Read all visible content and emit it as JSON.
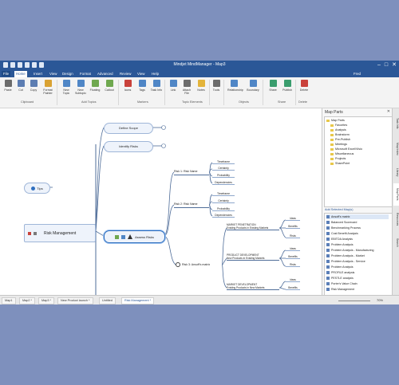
{
  "window": {
    "title": "Mindjet MindManager - Map3"
  },
  "ribbon_tabs": [
    "File",
    "Home",
    "Insert",
    "View",
    "Design",
    "Format",
    "Advanced",
    "Review",
    "View",
    "Help"
  ],
  "user": "Fred",
  "ribbon": {
    "buttons": [
      {
        "label": "Paste",
        "color": "#6b6b6b"
      },
      {
        "label": "Cut",
        "color": "#5c7db2"
      },
      {
        "label": "Copy",
        "color": "#5c7db2"
      },
      {
        "label": "Format Painter",
        "color": "#d9a233"
      },
      {
        "label": "New Topic",
        "color": "#4f86c6"
      },
      {
        "label": "New Subtopic",
        "color": "#4f86c6"
      },
      {
        "label": "Floating",
        "color": "#6fa84f"
      },
      {
        "label": "Callout",
        "color": "#6fa84f"
      },
      {
        "label": "Icons",
        "color": "#c9423b"
      },
      {
        "label": "Tags",
        "color": "#4f86c6"
      },
      {
        "label": "Task Info",
        "color": "#4f86c6"
      },
      {
        "label": "Link",
        "color": "#4f86c6"
      },
      {
        "label": "Attach File",
        "color": "#6b6b6b"
      },
      {
        "label": "Notes",
        "color": "#e3b43b"
      },
      {
        "label": "Tools",
        "color": "#6b6b6b"
      },
      {
        "label": "Relationship",
        "color": "#4f86c6"
      },
      {
        "label": "Boundary",
        "color": "#4f86c6"
      },
      {
        "label": "Share",
        "color": "#3a9d6e"
      },
      {
        "label": "Publish",
        "color": "#3a9d6e"
      },
      {
        "label": "Delete",
        "color": "#c9423b"
      }
    ],
    "groups": [
      "Clipboard",
      "Add Topics",
      "Markers",
      "Topic Elements",
      "Objects",
      "Share",
      "Delete"
    ]
  },
  "map": {
    "central": "Risk Management",
    "topics": {
      "define_scope": "Define Scope",
      "identify_risks": "Identify Risks",
      "assess_risks": "Assess Risks",
      "tips": "Tips"
    },
    "risk1": "Risk 1: Risk Name",
    "risk2": "Risk 2: Risk Name",
    "risk3": "Risk 3: Ansoff's matrix",
    "risk_children": [
      "Timeframe",
      "Certainty",
      "Probability",
      "Dependencies"
    ],
    "market_penetration": "MARKET PENETRATION\nExisting Products in Existing Markets",
    "product_development": "PRODUCT DEVELOPMENT\nNew Products in Existing Markets",
    "market_development": "MARKET DEVELOPMENT\nExisting Products in New Markets",
    "mp_children": [
      "Ideas",
      "Benefits",
      "Risks"
    ],
    "pd_children": [
      "Ideas",
      "Benefits",
      "Risks"
    ],
    "md_children": [
      "Ideas",
      "Benefits",
      "Risks"
    ]
  },
  "panel": {
    "title": "Map Parts",
    "tree": [
      "Map Parts",
      "Favorites",
      "Analysis",
      "Brainstorm",
      "Pre-Publish",
      "Meetings",
      "Microsoft Excel/Visio",
      "Miscellaneous",
      "Projects",
      "SharePoint"
    ],
    "recent_header": "Add Selected Map(s)",
    "recent": [
      "Ansoff's matrix",
      "Balanced Scorecard",
      "Benchmarking Process",
      "Cost Benefit Analysis",
      "EBITDA Analysis",
      "Problem Analysis",
      "Problem Analysis - Manufacturing",
      "Problem Analysis - Market",
      "Problem Analysis - Service",
      "Problem Analysis",
      "PROFILE analysis",
      "PESTLE analysis",
      "Porter's Value Chain",
      "Risk Management"
    ]
  },
  "side_tabs": [
    "Task Info",
    "Map Index",
    "Library",
    "Map Parts",
    "Resources",
    "Search"
  ],
  "documents": [
    "Map1",
    "Map2 *",
    "Map3 *",
    "New Product launch *",
    "Untitled",
    "Risk Management *"
  ],
  "zoom": "70%"
}
